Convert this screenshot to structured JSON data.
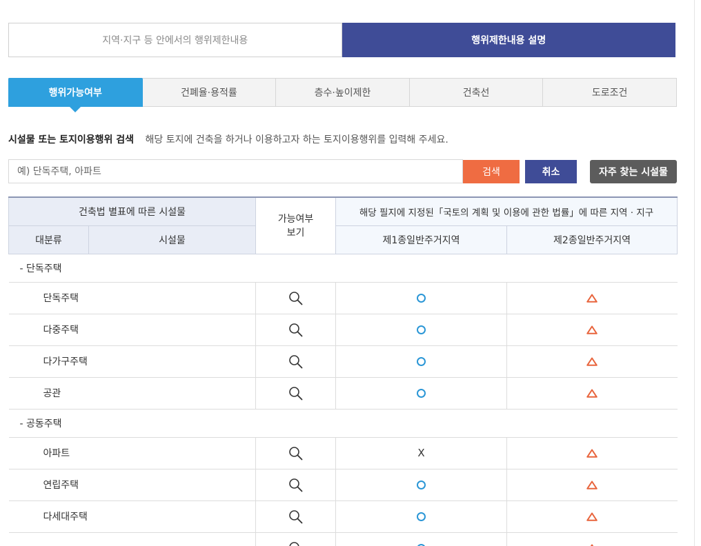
{
  "top_toggle": {
    "left_label": "지역·지구 등 안에서의 행위제한내용",
    "right_label": "행위제한내용 설명"
  },
  "sub_tabs": [
    {
      "label": "행위가능여부",
      "active": true
    },
    {
      "label": "건폐율·용적률",
      "active": false
    },
    {
      "label": "층수·높이제한",
      "active": false
    },
    {
      "label": "건축선",
      "active": false
    },
    {
      "label": "도로조건",
      "active": false
    }
  ],
  "search": {
    "title": "시설물 또는 토지이용행위 검색",
    "description": "해당 토지에 건축을 하거나 이용하고자 하는 토지이용행위를 입력해 주세요.",
    "placeholder": "예) 단독주택, 아파트",
    "search_button": "검색",
    "cancel_button": "취소",
    "frequent_button": "자주 찾는 시설물"
  },
  "table": {
    "header_facility_group": "건축법 별표에 따른 시설물",
    "header_category": "대분류",
    "header_facility": "시설물",
    "header_view": "가능여부\n보기",
    "header_zone_group": "해당 필지에 지정된「국토의 계획 및 이용에 관한 법률」에 따른 지역 · 지구",
    "zone_1": "제1종일반주거지역",
    "zone_2": "제2종일반주거지역",
    "groups": [
      {
        "label": "- 단독주택",
        "rows": [
          {
            "name": "단독주택",
            "zone1": "O",
            "zone2": "△"
          },
          {
            "name": "다중주택",
            "zone1": "O",
            "zone2": "△"
          },
          {
            "name": "다가구주택",
            "zone1": "O",
            "zone2": "△"
          },
          {
            "name": "공관",
            "zone1": "O",
            "zone2": "△"
          }
        ]
      },
      {
        "label": "- 공동주택",
        "rows": [
          {
            "name": "아파트",
            "zone1": "X",
            "zone2": "△"
          },
          {
            "name": "연립주택",
            "zone1": "O",
            "zone2": "△"
          },
          {
            "name": "다세대주택",
            "zone1": "O",
            "zone2": "△"
          },
          {
            "name": "",
            "zone1": "O",
            "zone2": "△"
          }
        ]
      }
    ]
  },
  "colors": {
    "navy": "#3f4c97",
    "tab_blue": "#2ea0de",
    "search_orange": "#ef6c42",
    "freq_gray": "#5c5c5c",
    "possible_blue": "#2a96d6",
    "conditional_orange": "#e8643c"
  }
}
